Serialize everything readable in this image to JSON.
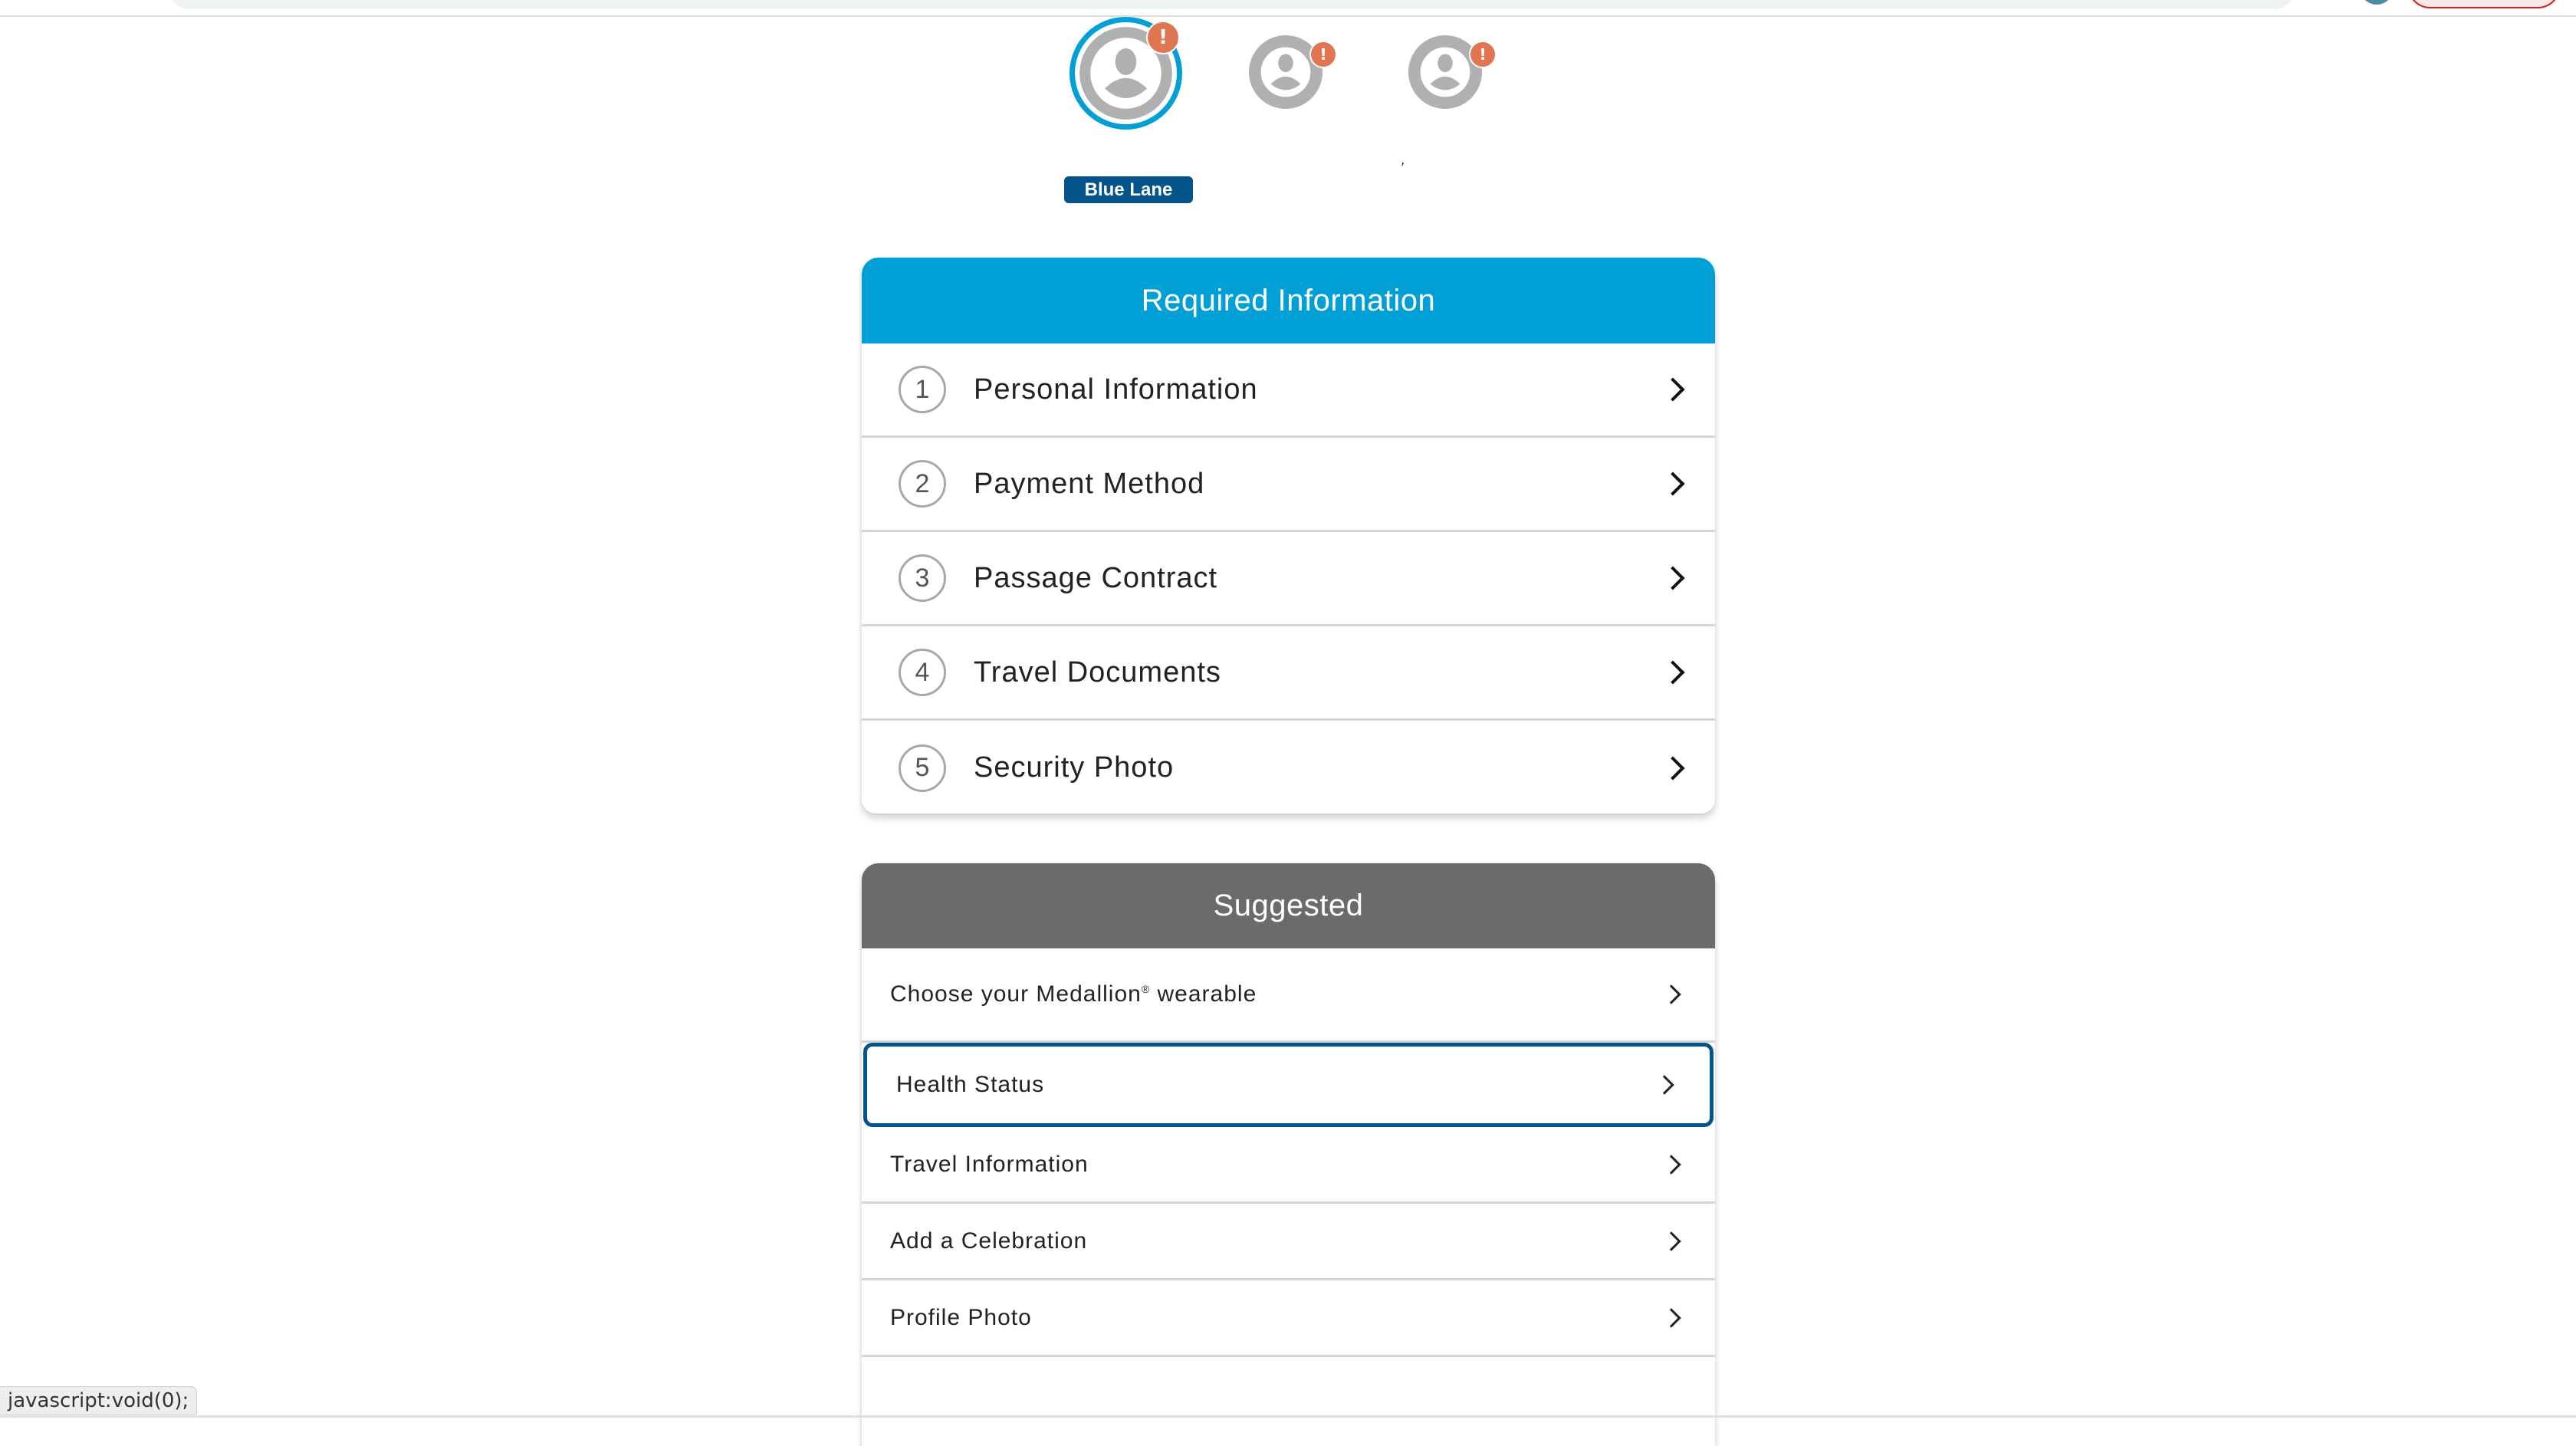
{
  "browser": {
    "status_url": "javascript:void(0);"
  },
  "guests": [
    {
      "name": "guest-1",
      "selected": true,
      "alert": "!",
      "icon": "user-avatar-icon"
    },
    {
      "name": "guest-2",
      "selected": false,
      "alert": "!",
      "icon": "user-avatar-icon"
    },
    {
      "name": "guest-3",
      "selected": false,
      "alert": "!",
      "icon": "user-avatar-icon"
    }
  ],
  "stray_mark": ",",
  "lane_badge": "Blue Lane",
  "required": {
    "title": "Required Information",
    "color": "#00a0d6",
    "items": [
      {
        "number": "1",
        "label": "Personal Information"
      },
      {
        "number": "2",
        "label": "Payment Method"
      },
      {
        "number": "3",
        "label": "Passage Contract"
      },
      {
        "number": "4",
        "label": "Travel Documents"
      },
      {
        "number": "5",
        "label": "Security Photo"
      }
    ]
  },
  "suggested": {
    "title": "Suggested",
    "color": "#6b6b6b",
    "items": [
      {
        "label": "Choose your Medallion",
        "sup": "®",
        "suffix": " wearable"
      },
      {
        "label": "Health Status",
        "focused": true
      },
      {
        "label": "Travel Information"
      },
      {
        "label": "Add a Celebration"
      },
      {
        "label": "Profile Photo"
      }
    ]
  },
  "colors": {
    "focus_border": "#02548b",
    "alert": "#e07651",
    "badge": "#02548b"
  }
}
